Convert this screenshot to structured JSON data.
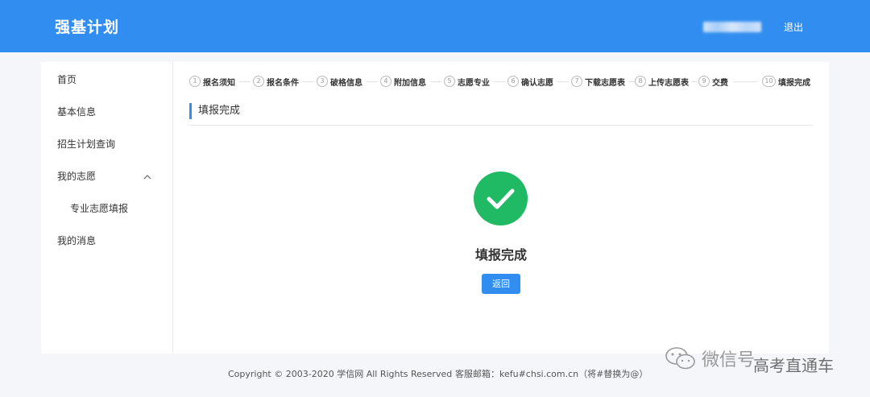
{
  "header": {
    "brand": "强基计划",
    "logout_label": "退出"
  },
  "sidebar": {
    "items": [
      {
        "label": "首页"
      },
      {
        "label": "基本信息"
      },
      {
        "label": "招生计划查询"
      },
      {
        "label": "我的志愿"
      },
      {
        "label": "专业志愿填报"
      },
      {
        "label": "我的消息"
      }
    ]
  },
  "steps": [
    {
      "num": "1",
      "label": "报名须知"
    },
    {
      "num": "2",
      "label": "报名条件"
    },
    {
      "num": "3",
      "label": "破格信息"
    },
    {
      "num": "4",
      "label": "附加信息"
    },
    {
      "num": "5",
      "label": "志愿专业"
    },
    {
      "num": "6",
      "label": "确认志愿"
    },
    {
      "num": "7",
      "label": "下载志愿表"
    },
    {
      "num": "8",
      "label": "上传志愿表"
    },
    {
      "num": "9",
      "label": "交费"
    },
    {
      "num": "10",
      "label": "填报完成"
    }
  ],
  "main": {
    "section_title": "填报完成",
    "done_text": "填报完成",
    "back_label": "返回"
  },
  "footer": {
    "copyright": "Copyright © 2003-2020 学信网 All Rights Reserved",
    "email": "客服邮箱：kefu#chsi.com.cn（将#替换为@）"
  },
  "watermark": {
    "text1": "微信号",
    "text2": "高考直通车"
  },
  "colors": {
    "primary": "#318ef0",
    "success": "#20b964"
  }
}
